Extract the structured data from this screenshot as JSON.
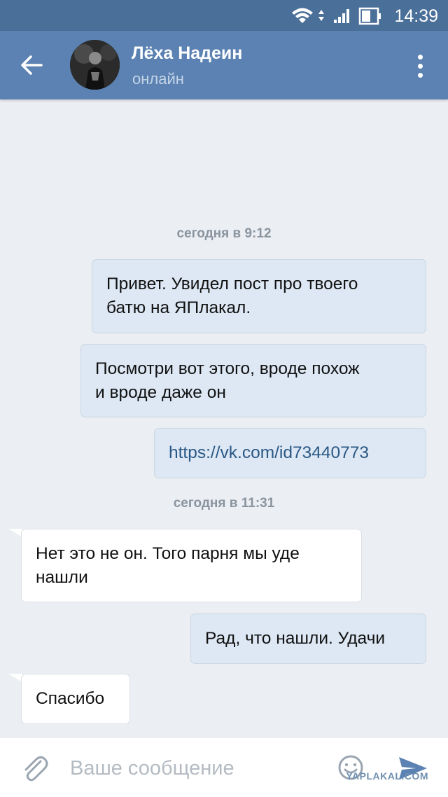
{
  "status_bar": {
    "time": "14:39"
  },
  "header": {
    "contact_name": "Лёха Надеин",
    "contact_status": "онлайн"
  },
  "chat": {
    "date_1": "сегодня в 9:12",
    "date_2": "сегодня в 11:31",
    "messages": [
      {
        "direction": "out",
        "lines": [
          "Привет. Увидел пост про твоего",
          "батю на ЯПлакал."
        ]
      },
      {
        "direction": "out",
        "lines": [
          "Посмотри вот этого, вроде похож",
          "и вроде даже он"
        ]
      },
      {
        "direction": "out",
        "lines": [
          "https://vk.com/id73440773"
        ],
        "is_link": true
      },
      {
        "direction": "in",
        "lines": [
          "Нет это не он. Того парня мы уде",
          "нашли"
        ]
      },
      {
        "direction": "out",
        "lines": [
          "Рад, что нашли. Удачи"
        ]
      },
      {
        "direction": "in",
        "lines": [
          "Спасибо"
        ]
      }
    ]
  },
  "input": {
    "placeholder": "Ваше сообщение",
    "value": ""
  },
  "watermark": "YAPLAKAL.COM",
  "colors": {
    "header": "#5b82b2",
    "status_bar": "#4a6f98",
    "bubble_out": "#dde8f4",
    "bubble_in": "#ffffff",
    "link": "#2a5885",
    "send": "#5b82b2"
  }
}
